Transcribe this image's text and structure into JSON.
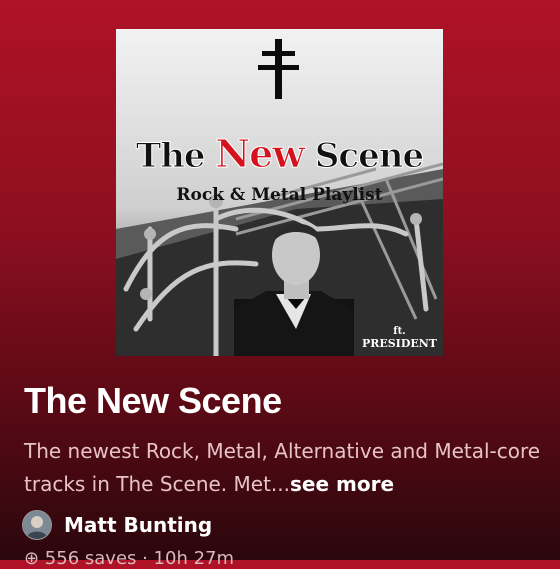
{
  "cover": {
    "title_part1": "The ",
    "title_highlight": "New",
    "title_part2": " Scene",
    "subtitle": "Rock & Metal Playlist",
    "ft_label": "ft.",
    "ft_name": "PRESIDENT"
  },
  "playlist": {
    "title": "The New Scene",
    "description": "The newest Rock, Metal, Alternative and Metal-core tracks in The Scene. Met...",
    "see_more": "see more",
    "owner": "Matt Bunting",
    "meta": "⊕ 556 saves · 10h 27m"
  }
}
